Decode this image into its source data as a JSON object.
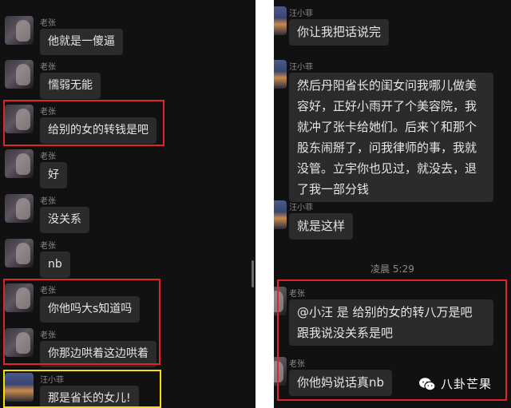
{
  "left_panel": {
    "messages": [
      {
        "sender": "老张",
        "text": "他就是一傻逼"
      },
      {
        "sender": "老张",
        "text": "懦弱无能"
      },
      {
        "sender": "老张",
        "text": "给别的女的转钱是吧"
      },
      {
        "sender": "老张",
        "text": "好"
      },
      {
        "sender": "老张",
        "text": "没关系"
      },
      {
        "sender": "老张",
        "text": "nb"
      },
      {
        "sender": "老张",
        "text": "你他吗大s知道吗"
      },
      {
        "sender": "老张",
        "text": "你那边哄着这边哄着"
      },
      {
        "sender": "汪小菲",
        "text": "那是省长的女儿!"
      }
    ]
  },
  "right_panel": {
    "messages": [
      {
        "sender": "汪小菲",
        "text": "你让我把话说完"
      },
      {
        "sender": "汪小菲",
        "text": "然后丹阳省长的闺女问我哪儿做美容好，正好小雨开了个美容院，我就冲了张卡给她们。后来丫和那个股东闹掰了，问我律师的事，我就没管。立宇你也见过，就没去，退了我一部分钱"
      },
      {
        "sender": "汪小菲",
        "text": "就是这样"
      },
      {
        "sender": "老张",
        "text": "@小汪 是 给别的女的转八万是吧 跟我说没关系是吧"
      },
      {
        "sender": "老张",
        "text": "你他妈说话真nb"
      }
    ],
    "timestamp": "凌晨 5:29"
  },
  "watermark": {
    "text": "八卦芒果"
  },
  "colors": {
    "background": "#111111",
    "bubble": "#2b2b2b",
    "bubble_text": "#e6e6e6",
    "highlight_red": "#e0242b",
    "highlight_yellow": "#f2e200"
  }
}
